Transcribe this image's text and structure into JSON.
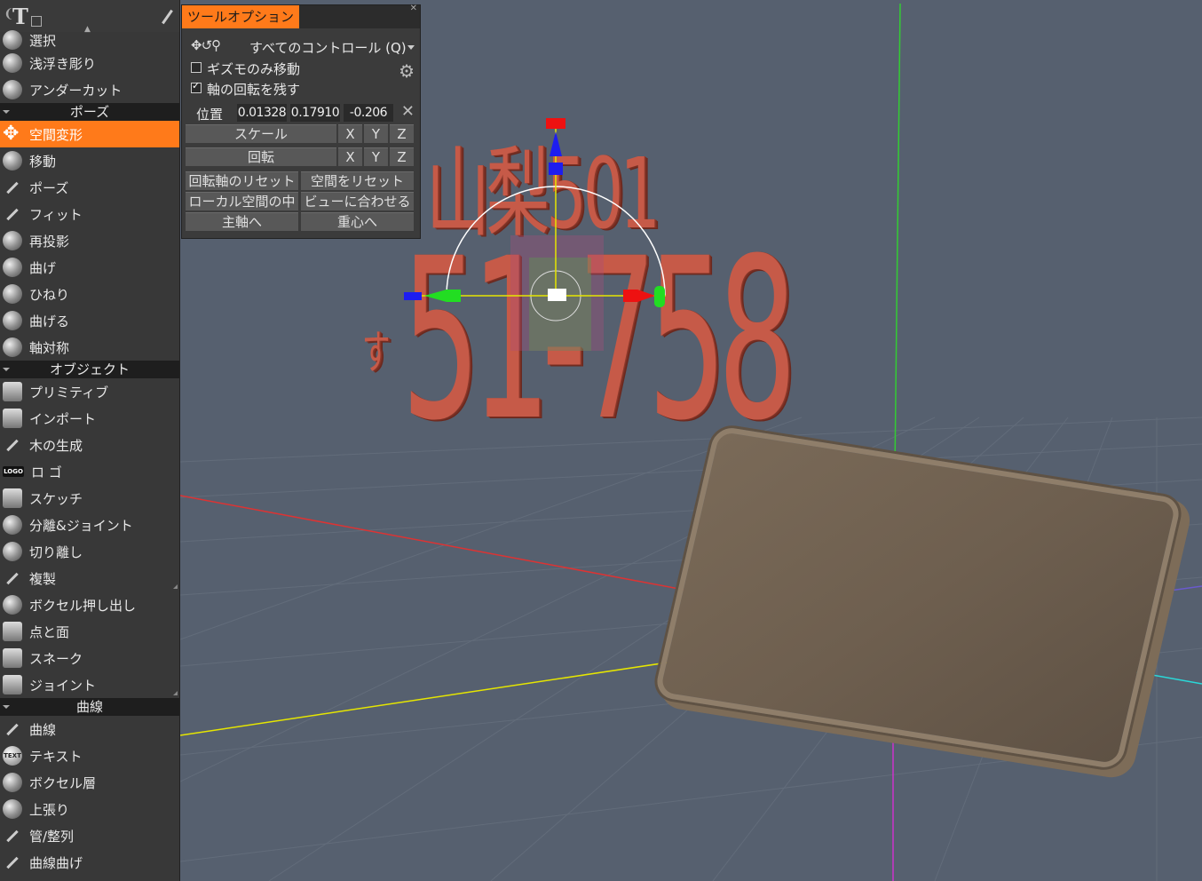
{
  "app": {
    "accent_color": "#ff7a1a"
  },
  "left_panel": {
    "top_partial_item": "選択",
    "items_top": [
      "浅浮き彫り",
      "アンダーカット"
    ],
    "sections": [
      {
        "title": "ポーズ",
        "items": [
          "空間変形",
          "移動",
          "ポーズ",
          "フィット",
          "再投影",
          "曲げ",
          "ひねり",
          "曲げる",
          "軸対称"
        ],
        "active_index": 0
      },
      {
        "title": "オブジェクト",
        "items": [
          "プリミティブ",
          "インポート",
          "木の生成",
          "ロ ゴ",
          "スケッチ",
          "分離&ジョイント",
          "切り離し",
          "複製",
          "ボクセル押し出し",
          "点と面",
          "スネーク",
          "ジョイント"
        ]
      },
      {
        "title": "曲線",
        "items": [
          "曲線",
          "テキスト",
          "ボクセル層",
          "上張り",
          "管/整列",
          "曲線曲げ"
        ]
      }
    ],
    "icon_labels": {
      "logo": "LOGO",
      "text": "TEXT"
    }
  },
  "tool_options": {
    "title": "ツールオプション",
    "control_mode": "すべてのコントロール (Q)",
    "gizmo_only": {
      "label": "ギズモのみ移動",
      "checked": false
    },
    "keep_axis_rotation": {
      "label": "軸の回転を残す",
      "checked": true
    },
    "position": {
      "label": "位置",
      "x": "0.01328",
      "y": "0.17910",
      "z": "-0.206"
    },
    "scale_label": "スケール",
    "rotate_label": "回転",
    "axis_x": "X",
    "axis_y": "Y",
    "axis_z": "Z",
    "buttons": {
      "reset_rotation_axis": "回転軸のリセット",
      "reset_space": "空間をリセット",
      "in_local_space": "ローカル空間の中",
      "fit_to_view": "ビューに合わせる",
      "to_principal_axis": "主軸へ",
      "to_centroid": "重心へ"
    }
  },
  "scene": {
    "plate_line1": "山梨501",
    "plate_kana": "す",
    "plate_number": "51-758",
    "text_color": "#c65a48",
    "plate_color": "#6e5f4f"
  }
}
